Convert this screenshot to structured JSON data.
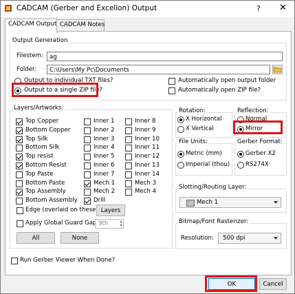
{
  "window": {
    "title": "CADCAM (Gerber and Excellon) Output",
    "help": "?",
    "close": "✕"
  },
  "tabs": [
    "CADCAM Output",
    "CADCAM Notes"
  ],
  "output_generation": {
    "group_label": "Output Generation",
    "filestem_label": "Filestem:",
    "filestem_value": "ag",
    "folder_label": "Folder:",
    "folder_value": "C:\\Users\\My Pc\\Documents",
    "opt_individual": "Output to individual TXT files?",
    "opt_single_zip": "Output to a single ZIP file?",
    "auto_open_folder": "Automatically open output folder",
    "auto_open_zip": "Automatically open ZIP file?"
  },
  "layers": {
    "group_label": "Layers/Artworks:",
    "col1": [
      {
        "label": "Top Copper",
        "checked": true
      },
      {
        "label": "Bottom Copper",
        "checked": true
      },
      {
        "label": "Top Silk",
        "checked": true
      },
      {
        "label": "Bottom Silk",
        "checked": false
      },
      {
        "label": "Top resist",
        "checked": true
      },
      {
        "label": "Bottom Resist",
        "checked": true
      },
      {
        "label": "Top Paste",
        "checked": false
      },
      {
        "label": "Bottom Paste",
        "checked": false
      },
      {
        "label": "Top Assembly",
        "checked": true
      },
      {
        "label": "Bottom Assembly",
        "checked": false
      }
    ],
    "col2": [
      {
        "label": "Inner 1",
        "checked": false
      },
      {
        "label": "Inner 2",
        "checked": false
      },
      {
        "label": "Inner 3",
        "checked": false
      },
      {
        "label": "Inner 4",
        "checked": false
      },
      {
        "label": "Inner 5",
        "checked": false
      },
      {
        "label": "Inner 6",
        "checked": false
      },
      {
        "label": "Inner 7",
        "checked": false
      },
      {
        "label": "Mech 1",
        "checked": true
      },
      {
        "label": "Mech 2",
        "checked": false
      },
      {
        "label": "Drill",
        "checked": true
      }
    ],
    "col3": [
      {
        "label": "Inner 8",
        "checked": false
      },
      {
        "label": "Inner 9",
        "checked": false
      },
      {
        "label": "Inner 10",
        "checked": false
      },
      {
        "label": "Inner 11",
        "checked": false
      },
      {
        "label": "Inner 12",
        "checked": false
      },
      {
        "label": "Inner 13",
        "checked": false
      },
      {
        "label": "Inner 14",
        "checked": false
      },
      {
        "label": "Mech 3",
        "checked": false
      },
      {
        "label": "Mech 4",
        "checked": false
      }
    ],
    "edge_label": "Edge (overlaid on these)",
    "layers_button": "Layers",
    "guard_label": "Apply Global Guard Gap",
    "guard_value": "9th",
    "all_button": "All",
    "none_button": "None"
  },
  "rotation": {
    "group_label": "Rotation:",
    "opt1": "X Horizontal",
    "opt2": "X Vertical"
  },
  "reflection": {
    "group_label": "Reflection:",
    "opt1": "Normal",
    "opt2": "Mirror"
  },
  "file_units": {
    "group_label": "File Units:",
    "opt1": "Metric (mm)",
    "opt2": "Imperial (thou)"
  },
  "gerber_format": {
    "group_label": "Gerber Format:",
    "opt1": "Gerber X2",
    "opt2": "RS274X"
  },
  "slotting": {
    "group_label": "Slotting/Routing Layer:",
    "value": "Mech 1"
  },
  "bitmap": {
    "group_label": "Bitmap/Font Rasterizer:",
    "resolution_label": "Resolution:",
    "value": "500 dpi"
  },
  "run_viewer": "Run Gerber Viewer When Done?",
  "ok": "OK",
  "cancel": "Cancel",
  "colors": {
    "highlight": "#e0121a"
  }
}
